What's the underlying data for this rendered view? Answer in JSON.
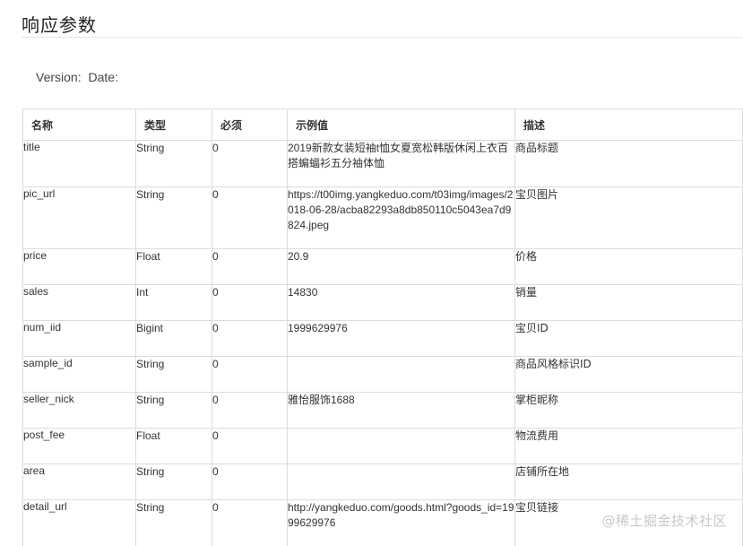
{
  "page": {
    "title": "响应参数",
    "version_label": "Version:",
    "date_label": "Date:"
  },
  "table": {
    "headers": [
      "名称",
      "类型",
      "必须",
      "示例值",
      "描述"
    ],
    "rows": [
      {
        "name": "title",
        "type": "String",
        "required": "0",
        "example": "2019新款女装短袖t恤女夏宽松韩版休闲上衣百搭蝙蝠衫五分袖体恤",
        "description": "商品标题"
      },
      {
        "name": "pic_url",
        "type": "String",
        "required": "0",
        "example": "https://t00img.yangkeduo.com/t03img/images/2018-06-28/acba82293a8db850110c5043ea7d9824.jpeg",
        "description": "宝贝图片"
      },
      {
        "name": "price",
        "type": "Float",
        "required": "0",
        "example": "20.9",
        "description": "价格"
      },
      {
        "name": "sales",
        "type": "Int",
        "required": "0",
        "example": "14830",
        "description": "销量"
      },
      {
        "name": "num_iid",
        "type": "Bigint",
        "required": "0",
        "example": "1999629976",
        "description": "宝贝ID"
      },
      {
        "name": "sample_id",
        "type": "String",
        "required": "0",
        "example": "",
        "description": "商品风格标识ID"
      },
      {
        "name": "seller_nick",
        "type": "String",
        "required": "0",
        "example": "雅怡服饰1688",
        "description": "掌柜昵称"
      },
      {
        "name": "post_fee",
        "type": "Float",
        "required": "0",
        "example": "",
        "description": "物流费用"
      },
      {
        "name": "area",
        "type": "String",
        "required": "0",
        "example": "",
        "description": "店铺所在地"
      },
      {
        "name": "detail_url",
        "type": "String",
        "required": "0",
        "example": "http://yangkeduo.com/goods.html?goods_id=1999629976",
        "description": "宝贝链接"
      }
    ]
  },
  "watermark": "@稀土掘金技术社区"
}
